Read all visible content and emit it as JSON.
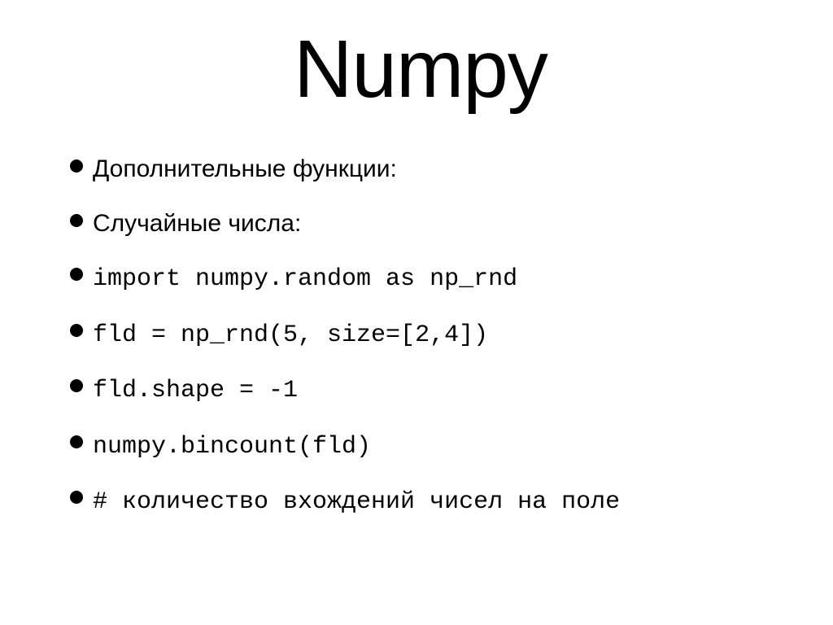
{
  "title": "Numpy",
  "bullets": [
    {
      "text": "Дополнительные функции:",
      "cls": "sans"
    },
    {
      "text": "Случайные числа:",
      "cls": "sans"
    },
    {
      "text": "import numpy.random as np_rnd",
      "cls": "mono"
    },
    {
      "text": "fld = np_rnd(5, size=[2,4])",
      "cls": "mono"
    },
    {
      "text": "fld.shape = -1",
      "cls": "mono"
    },
    {
      "text": "numpy.bincount(fld)",
      "cls": "mono"
    },
    {
      "text": "# количество вхождений чисел на поле",
      "cls": "mono"
    }
  ]
}
